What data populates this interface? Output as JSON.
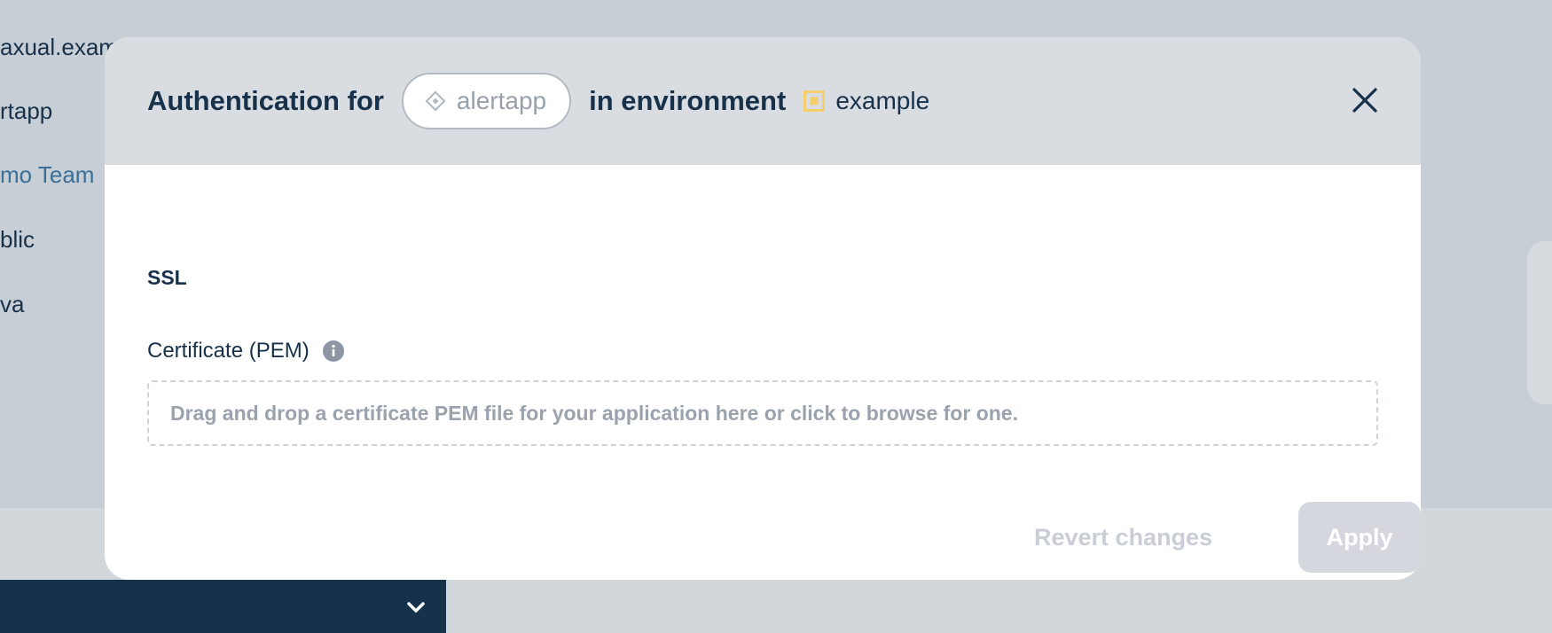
{
  "background": {
    "list_items": [
      "axual.exam",
      "rtapp",
      "mo Team",
      "blic",
      "va"
    ]
  },
  "modal": {
    "title_prefix": "Authentication for",
    "app_name": "alertapp",
    "title_middle": "in environment",
    "environment_name": "example",
    "environment_color": "#f5cf6b",
    "close_icon": "close-icon"
  },
  "ssl": {
    "section_title": "SSL",
    "certificate_label": "Certificate (PEM)",
    "dropzone_text": "Drag and drop a certificate PEM file for your application here or click to browse for one."
  },
  "actions": {
    "revert_label": "Revert changes",
    "apply_label": "Apply"
  }
}
